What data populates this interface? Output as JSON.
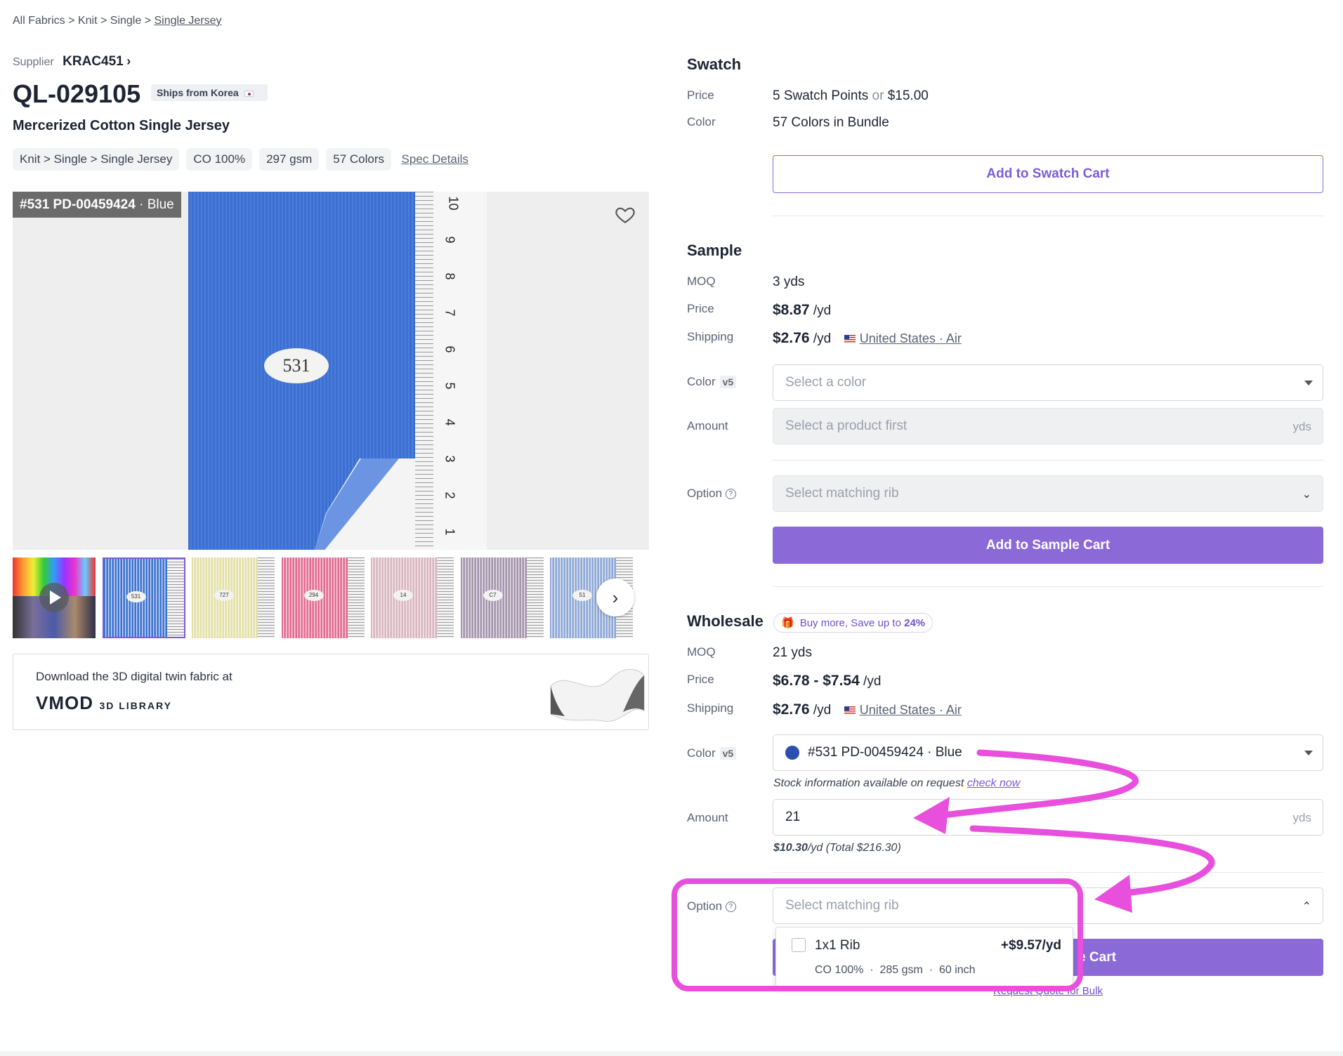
{
  "breadcrumb": {
    "items": [
      "All Fabrics",
      "Knit",
      "Single",
      "Single Jersey"
    ],
    "sep": ">"
  },
  "supplier": {
    "label": "Supplier",
    "name": "KRAC451"
  },
  "product": {
    "code": "QL-029105",
    "ships_badge": "Ships from Korea",
    "name": "Mercerized Cotton Single Jersey",
    "chips": [
      "Knit > Single > Single Jersey",
      "CO 100%",
      "297 gsm",
      "57 Colors"
    ],
    "spec_link": "Spec Details"
  },
  "gallery": {
    "image_caption_code": "#531 PD-00459424",
    "image_caption_color": "Blue",
    "swatch_label": "531",
    "ruler_numbers": [
      "10",
      "9",
      "8",
      "7",
      "6",
      "5",
      "4",
      "3",
      "2",
      "1"
    ],
    "thumb_labels": [
      "",
      "531",
      "727",
      "294",
      "14",
      "C7",
      "51"
    ],
    "thumb_colors": [
      "#7b6a8c",
      "#3f74d1",
      "#e4e0a7",
      "#e46c92",
      "#d9b6c0",
      "#a596ad",
      "#8ea8d6"
    ]
  },
  "banner": {
    "text": "Download the 3D digital twin fabric at",
    "logo": "VMOD",
    "logo_sub": "3D LIBRARY"
  },
  "swatch": {
    "title": "Swatch",
    "price_label": "Price",
    "price_points": "5 Swatch Points",
    "price_or": "or",
    "price_money": "$15.00",
    "color_label": "Color",
    "color_value": "57 Colors in Bundle",
    "button": "Add to Swatch Cart"
  },
  "sample": {
    "title": "Sample",
    "moq_label": "MOQ",
    "moq_value": "3 yds",
    "price_label": "Price",
    "price_value": "$8.87",
    "price_unit": "/yd",
    "shipping_label": "Shipping",
    "shipping_value": "$2.76",
    "shipping_unit": "/yd",
    "ship_dest": "United States",
    "ship_mode": "Air",
    "color_label": "Color",
    "color_tag": "v5",
    "color_placeholder": "Select a color",
    "amount_label": "Amount",
    "amount_placeholder": "Select a product first",
    "amount_unit": "yds",
    "option_label": "Option",
    "option_placeholder": "Select matching rib",
    "button": "Add to Sample Cart"
  },
  "wholesale": {
    "title": "Wholesale",
    "promo": "Buy more, Save up to",
    "promo_pct": "24%",
    "moq_label": "MOQ",
    "moq_value": "21 yds",
    "price_label": "Price",
    "price_value": "$6.78 - $7.54",
    "price_unit": "/yd",
    "shipping_label": "Shipping",
    "shipping_value": "$2.76",
    "shipping_unit": "/yd",
    "ship_dest": "United States",
    "ship_mode": "Air",
    "color_label": "Color",
    "color_tag": "v5",
    "color_selected": "#531 PD-00459424 · Blue",
    "color_dot": "#2a4fb0",
    "stock_note": "Stock information available on request",
    "stock_link": "check now",
    "amount_label": "Amount",
    "amount_value": "21",
    "amount_unit": "yds",
    "amount_price": "$10.30",
    "amount_total": "/yd (Total $216.30)",
    "option_label": "Option",
    "option_placeholder": "Select matching rib",
    "dropdown_item_name": "1x1 Rib",
    "dropdown_item_price": "+$9.57/yd",
    "dropdown_item_specs": [
      "CO 100%",
      "285 gsm",
      "60 inch"
    ],
    "button_visible": "e Cart",
    "quote_link": "Request Quote for Bulk"
  },
  "colors": {
    "accent": "#8b6ad8",
    "annotation": "#e84fdc",
    "text": "#1d2433"
  }
}
